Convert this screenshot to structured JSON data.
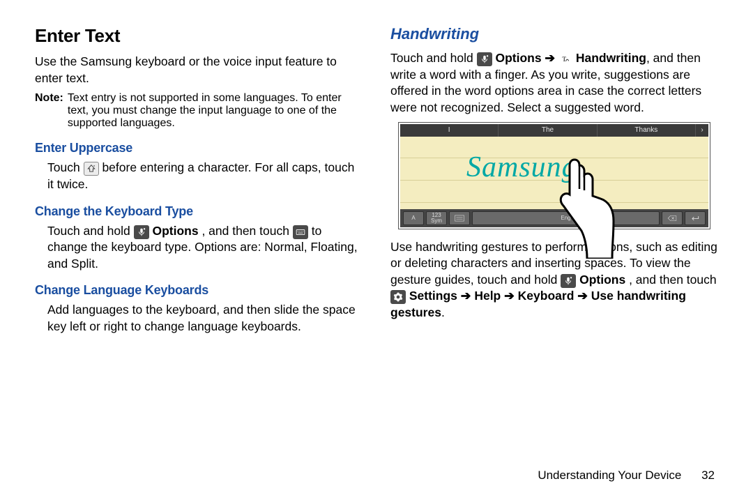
{
  "left": {
    "h1": "Enter Text",
    "intro": "Use the Samsung keyboard or the voice input feature to enter text.",
    "noteLabel": "Note:",
    "noteBody": "Text entry is not supported in some languages. To enter text, you must change the input language to one of the supported languages.",
    "sec1": "Enter Uppercase",
    "sec1_a": "Touch ",
    "sec1_b": " before entering a character. For all caps, touch it twice.",
    "sec2": "Change the Keyboard Type",
    "sec2_a": "Touch and hold ",
    "sec2_b": " Options",
    "sec2_c": ", and then touch ",
    "sec2_d": " to change the keyboard type. Options are: Normal, Floating, and Split.",
    "sec3": "Change Language Keyboards",
    "sec3_body": "Add languages to the keyboard, and then slide the space key left or right to change language keyboards."
  },
  "right": {
    "h2": "Handwriting",
    "p1_a": "Touch and hold ",
    "p1_b": " Options ",
    "arrow": "➔",
    "p1_c": " Handwriting",
    "p1_d": ", and then write a word with a finger. As you write, suggestions are offered in the word options area in case the correct letters were not recognized. Select a suggested word.",
    "suggest": {
      "s1": "I",
      "s2": "The",
      "s3": "Thanks",
      "s4": "›"
    },
    "handwrite": "Samsung",
    "toolbar": {
      "k2": "123\nSym",
      "k4": "Eng"
    },
    "p2_a": "Use handwriting gestures to perform actions, such as editing or deleting characters and inserting spaces. To view the gesture guides, touch and hold ",
    "p2_b": " Options",
    "p2_c": ", and then touch ",
    "p2_d": " Settings ",
    "p2_e": " Help ",
    "p2_f": " Keyboard ",
    "p2_g": " Use handwriting gestures",
    "p2_h": "."
  },
  "footer": {
    "section": "Understanding Your Device",
    "page": "32"
  }
}
